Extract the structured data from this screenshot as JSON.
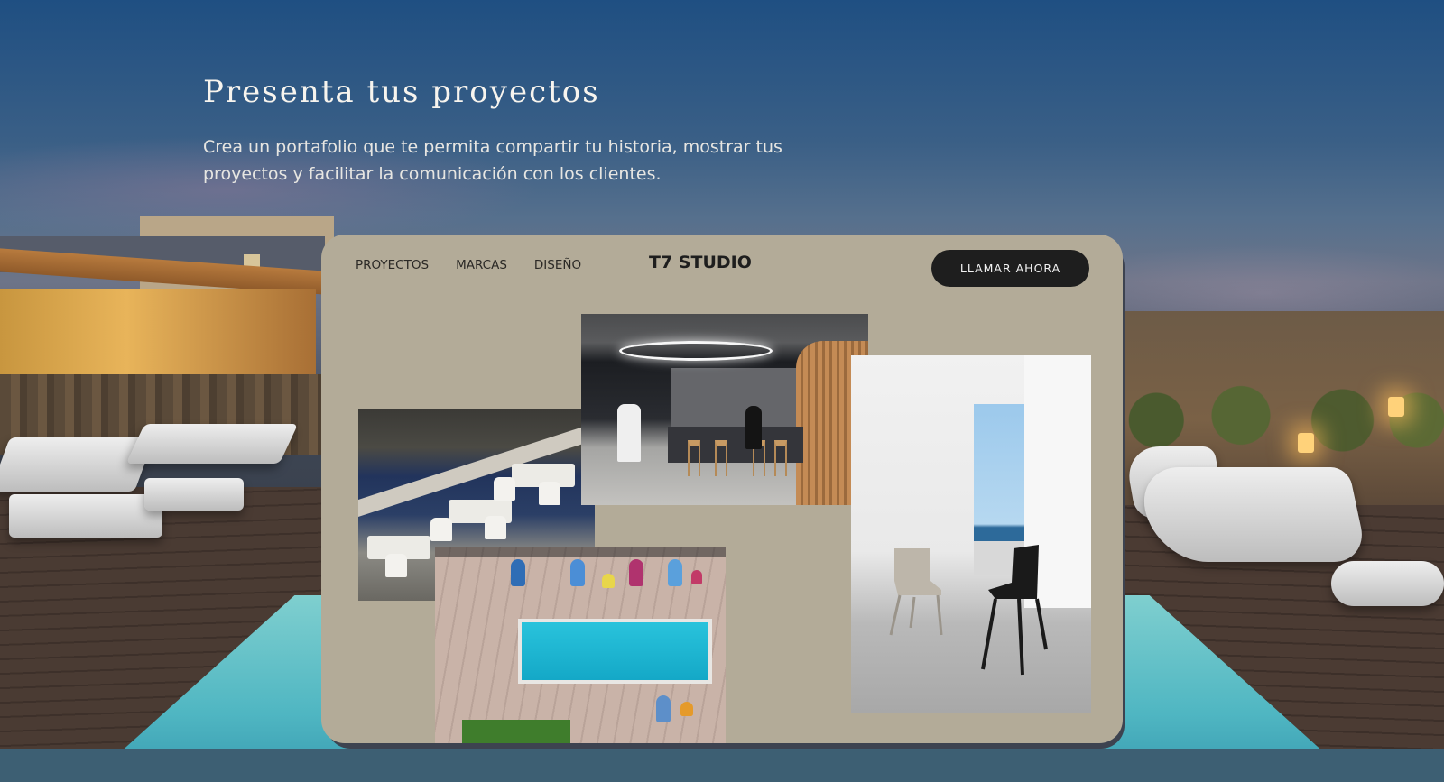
{
  "hero": {
    "title": "Presenta tus proyectos",
    "description": "Crea un portafolio que te permita compartir tu historia, mostrar tus proyectos y facilitar la comunicación con los clientes."
  },
  "card": {
    "nav": {
      "items": [
        {
          "label": "PROYECTOS"
        },
        {
          "label": "MARCAS"
        },
        {
          "label": "DISEÑO"
        }
      ]
    },
    "brand": "T7 STUDIO",
    "cta_label": "LLAMAR AHORA"
  },
  "colors": {
    "card_background": "#b3ab98",
    "cta_background": "#1e1e1e",
    "hero_text": "#f7f4ee"
  }
}
